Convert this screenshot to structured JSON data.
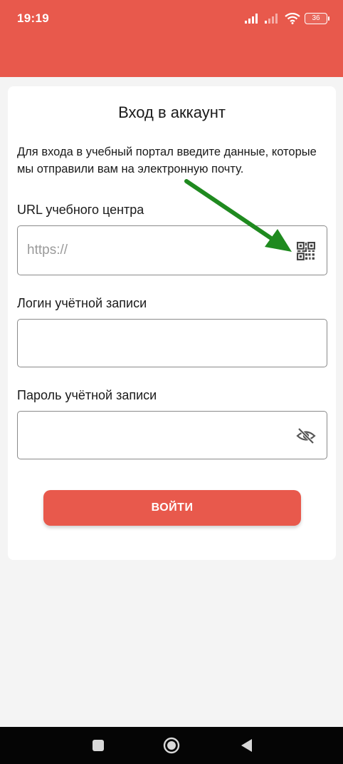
{
  "status_bar": {
    "time": "19:19",
    "battery": "36",
    "icons": [
      "signal-icon",
      "signal-weak-icon",
      "wifi-icon",
      "battery-icon"
    ]
  },
  "colors": {
    "brand": "#e8594c",
    "annotation_arrow": "#1f8a1f"
  },
  "login_card": {
    "title": "Вход в аккаунт",
    "description": "Для входа в учебный портал введите данные, которые мы отправили вам на электронную почту.",
    "url_field": {
      "label": "URL учебного центра",
      "placeholder": "https://",
      "value": "",
      "icon": "qr-code-icon"
    },
    "login_field": {
      "label": "Логин учётной записи",
      "value": ""
    },
    "password_field": {
      "label": "Пароль учётной записи",
      "value": "",
      "icon": "eye-off-icon"
    },
    "submit_label": "ВОЙТИ"
  },
  "nav_bar": {
    "buttons": [
      "recents-button",
      "home-button",
      "back-button"
    ]
  }
}
